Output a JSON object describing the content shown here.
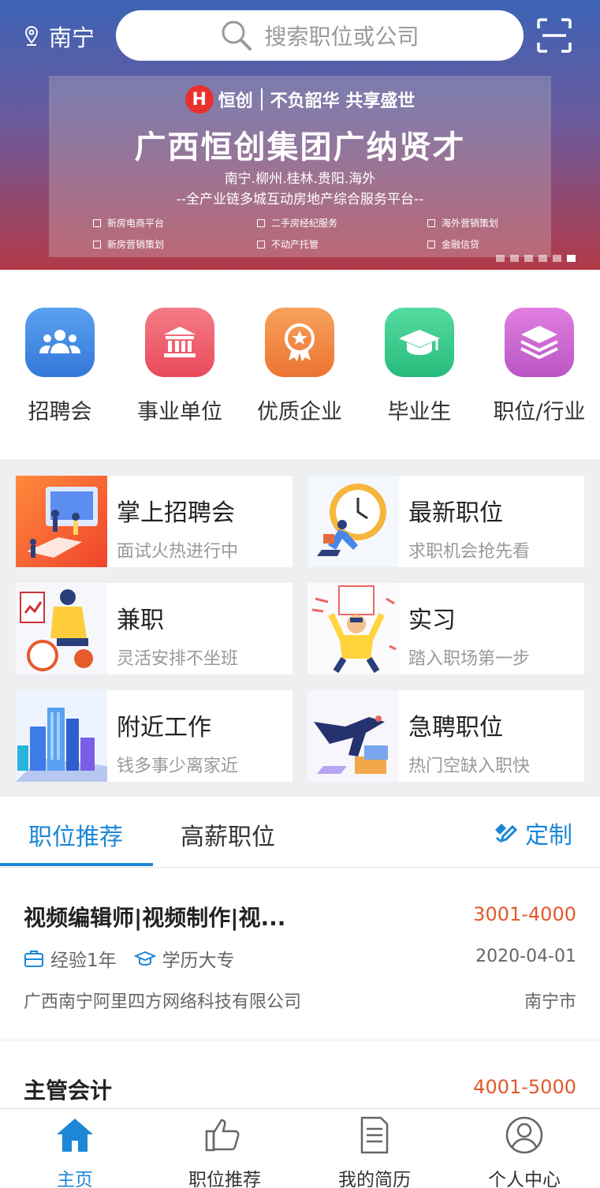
{
  "header": {
    "city": "南宁",
    "search_placeholder": "搜索职位或公司"
  },
  "banner": {
    "brand": "恒创",
    "brand_mark": "H",
    "slogan": "不负韶华 共享盛世",
    "title": "广西恒创集团广纳贤才",
    "cities": "南宁.柳州.桂林.贵阳.海外",
    "subtitle": "--全产业链多城互动房地产综合服务平台--",
    "features": [
      "新房电商平台",
      "二手房经纪服务",
      "海外营销策划",
      "新房营销策划",
      "不动产托管",
      "金融信贷"
    ],
    "slide_count": 6,
    "active_slide": 6
  },
  "categories": [
    {
      "label": "招聘会",
      "color": "#3f86e0"
    },
    {
      "label": "事业单位",
      "color": "#ef5f6f"
    },
    {
      "label": "优质企业",
      "color": "#ef8a3c"
    },
    {
      "label": "毕业生",
      "color": "#34c98c"
    },
    {
      "label": "职位/行业",
      "color": "#c966cc"
    }
  ],
  "cards": [
    {
      "title": "掌上招聘会",
      "subtitle": "面试火热进行中"
    },
    {
      "title": "最新职位",
      "subtitle": "求职机会抢先看"
    },
    {
      "title": "兼职",
      "subtitle": "灵活安排不坐班"
    },
    {
      "title": "实习",
      "subtitle": "踏入职场第一步"
    },
    {
      "title": "附近工作",
      "subtitle": "钱多事少离家近"
    },
    {
      "title": "急聘职位",
      "subtitle": "热门空缺入职快"
    }
  ],
  "tabs": {
    "items": [
      "职位推荐",
      "高薪职位"
    ],
    "active": 0,
    "custom_label": "定制"
  },
  "jobs": [
    {
      "title": "视频编辑师|视频制作|视...",
      "salary": "3001-4000",
      "experience": "经验1年",
      "education": "学历大专",
      "date": "2020-04-01",
      "company": "广西南宁阿里四方网络科技有限公司",
      "city": "南宁市"
    },
    {
      "title": "主管会计",
      "salary": "4001-5000"
    }
  ],
  "bottom_nav": {
    "items": [
      "主页",
      "职位推荐",
      "我的简历",
      "个人中心"
    ],
    "active": 0
  },
  "colors": {
    "accent": "#1b87d6",
    "salary": "#e2582b"
  }
}
